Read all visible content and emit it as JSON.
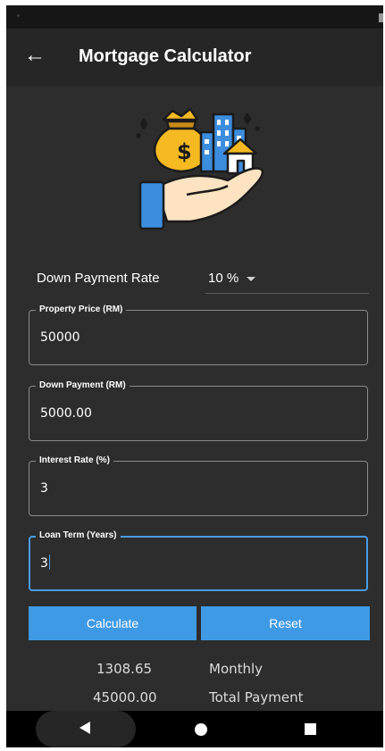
{
  "appbar": {
    "title": "Mortgage Calculator"
  },
  "down_payment_rate": {
    "label": "Down Payment Rate",
    "value": "10 %"
  },
  "fields": {
    "property_price": {
      "label": "Property Price (RM)",
      "value": "50000"
    },
    "down_payment": {
      "label": "Down Payment (RM)",
      "value": "5000.00"
    },
    "interest_rate": {
      "label": "Interest Rate (%)",
      "value": "3"
    },
    "loan_term": {
      "label": "Loan Term (Years)",
      "value": "3"
    }
  },
  "buttons": {
    "calculate": "Calculate",
    "reset": "Reset"
  },
  "results": {
    "monthly_value": "1308.65",
    "monthly_label": "Monthly",
    "total_value": "45000.00",
    "total_label": "Total Payment"
  },
  "colors": {
    "accent": "#3f9ae6",
    "background": "#2d2d2d",
    "appbar": "#262626",
    "coin_bag": "#f5b922",
    "hand": "#fde3c2",
    "building": "#3c8dde"
  },
  "icons": {
    "back": "arrow-left-icon",
    "illustration": "mortgage-hand-money-house-icon",
    "dropdown": "caret-down-icon"
  }
}
